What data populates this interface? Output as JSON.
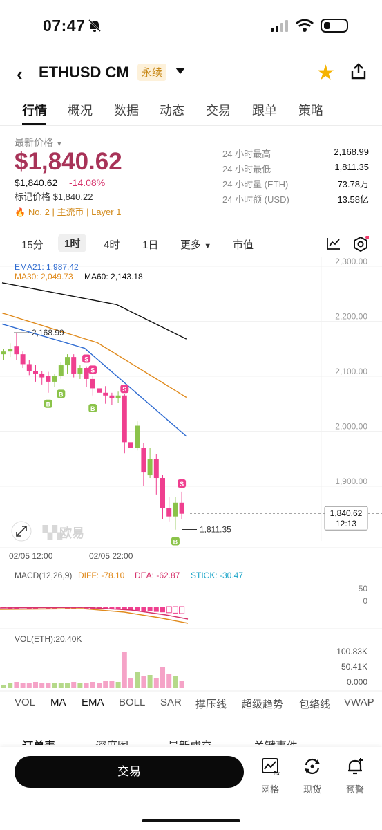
{
  "status_bar": {
    "time": "07:47"
  },
  "header": {
    "back_label": "‹",
    "title": "ETHUSD CM",
    "badge": "永续"
  },
  "tabs": [
    "行情",
    "概况",
    "数据",
    "动态",
    "交易",
    "跟单",
    "策略"
  ],
  "price": {
    "label": "最新价格",
    "last": "$1,840.62",
    "sub": "$1,840.62",
    "change_pct": "-14.08%",
    "mark_label": "标记价格 $1,840.22",
    "tags": "No. 2 | 主流币 | Layer 1"
  },
  "stats": [
    {
      "k": "24 小时最高",
      "v": "2,168.99"
    },
    {
      "k": "24 小时最低",
      "v": "1,811.35"
    },
    {
      "k": "24 小时量 (ETH)",
      "v": "73.78万"
    },
    {
      "k": "24 小时额 (USD)",
      "v": "13.58亿"
    }
  ],
  "intervals": [
    "15分",
    "1时",
    "4时",
    "1日",
    "更多",
    "市值"
  ],
  "chart": {
    "ema21": "EMA21: 1,987.42",
    "ma30": "MA30: 2,049.73",
    "ma60": "MA60: 2,143.18",
    "price_ticks": [
      "2,300.00",
      "2,200.00",
      "2,100.00",
      "2,000.00",
      "1,900.00"
    ],
    "high_label": "2,168.99",
    "low_label": "1,811.35",
    "current_price": "1,840.62",
    "countdown": "12:13",
    "watermark": "欧易",
    "time_ticks": [
      "02/05 12:00",
      "02/05 22:00"
    ],
    "colors": {
      "up": "#8bc34a",
      "down": "#ef3f8f",
      "ema": "#2e6bd1",
      "ma30": "#e08a1c",
      "ma60": "#111111"
    }
  },
  "macd": {
    "label": "MACD(12,26,9)",
    "diff": "DIFF: -78.10",
    "dea": "DEA: -62.87",
    "stick": "STICK: -30.47",
    "ticks": [
      "50",
      "0"
    ]
  },
  "vol": {
    "label": "VOL(ETH):20.40K",
    "ticks": [
      "100.83K",
      "50.41K",
      "0.000"
    ]
  },
  "indicators": [
    "VOL",
    "MA",
    "EMA",
    "BOLL",
    "SAR",
    "撑压线",
    "超级趋势",
    "包络线",
    "VWAP"
  ],
  "bottom_tabs": [
    "订单表",
    "深度图",
    "最新成交",
    "关键事件"
  ],
  "bottom_bar": {
    "trade": "交易",
    "items": [
      {
        "label": "网格"
      },
      {
        "label": "现货"
      },
      {
        "label": "预警"
      }
    ]
  }
}
